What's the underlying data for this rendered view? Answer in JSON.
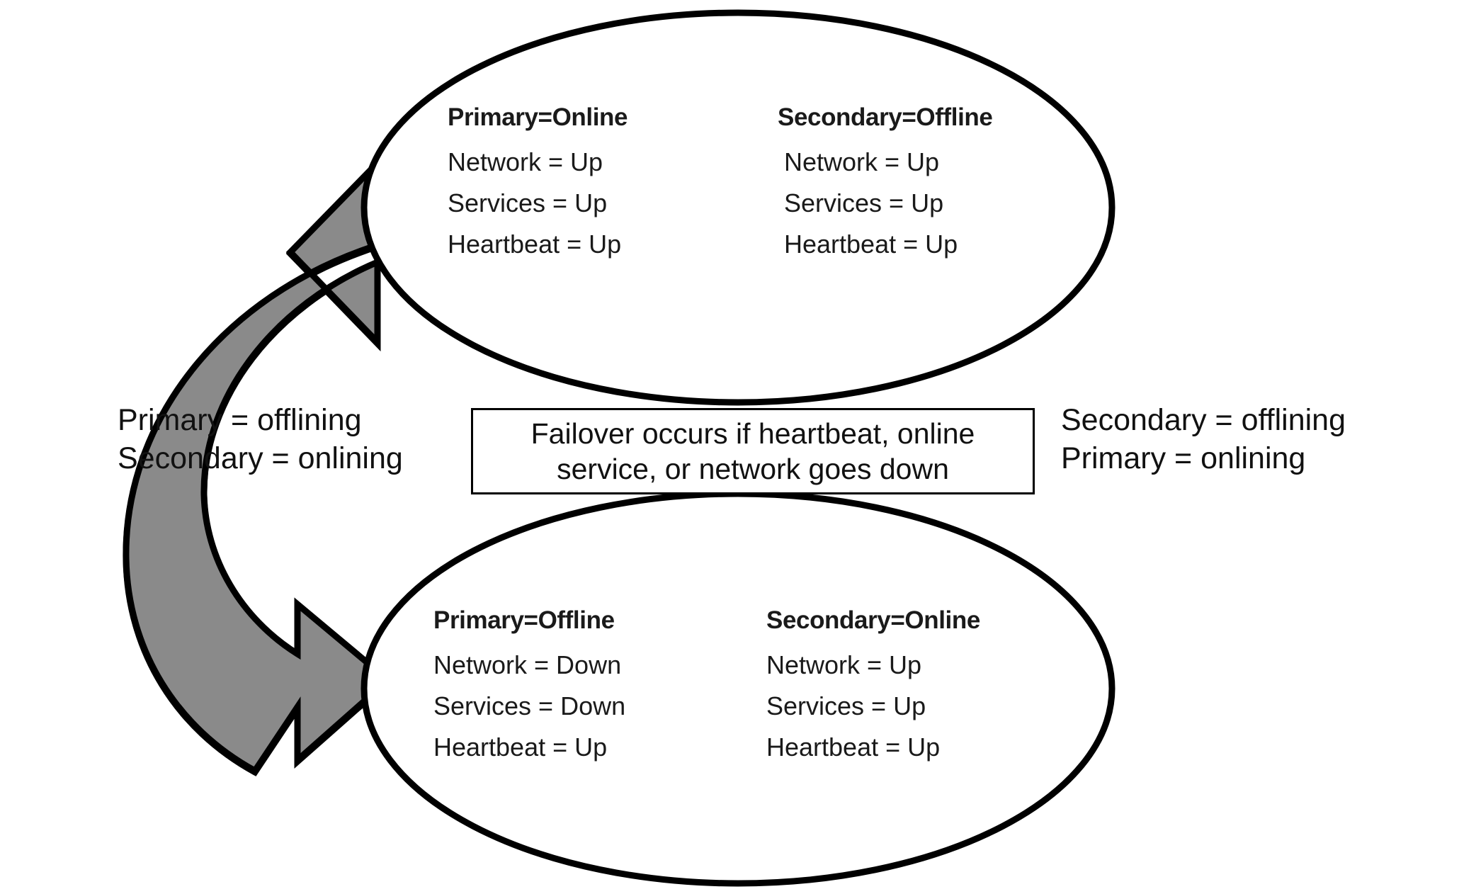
{
  "diagram": {
    "type": "cluster-failover-cycle",
    "background_color": "#ffffff",
    "outline_color": "#000000",
    "arrow_fill_light": "#8a8a8a",
    "arrow_fill_dark": "#5e5e5e",
    "text_color": "#111111"
  },
  "top_state": {
    "name": "top-state-ellipse",
    "left_column": {
      "title": "Primary=Online",
      "lines": [
        "Network = Up",
        "Services = Up",
        "Heartbeat = Up"
      ]
    },
    "right_column": {
      "title": "Secondary=Offline",
      "lines": [
        "Network = Up",
        "Services = Up",
        "Heartbeat  = Up"
      ]
    }
  },
  "bottom_state": {
    "name": "bottom-state-ellipse",
    "left_column": {
      "title": "Primary=Offline",
      "lines": [
        "Network = Down",
        "Services = Down",
        "Heartbeat = Up"
      ]
    },
    "right_column": {
      "title": "Secondary=Online",
      "lines": [
        "Network = Up",
        "Services = Up",
        "Heartbeat = Up"
      ]
    }
  },
  "left_transition": {
    "name": "left-transition-label",
    "line1": "Primary = offlining",
    "line2": "Secondary = onlining",
    "direction": "top-to-bottom"
  },
  "right_transition": {
    "name": "right-transition-label",
    "line1": "Secondary = offlining",
    "line2": "Primary = onlining",
    "direction": "bottom-to-top"
  },
  "center_note": {
    "name": "failover-condition-box",
    "line1": "Failover occurs if heartbeat, online",
    "line2": "service, or network goes down"
  }
}
